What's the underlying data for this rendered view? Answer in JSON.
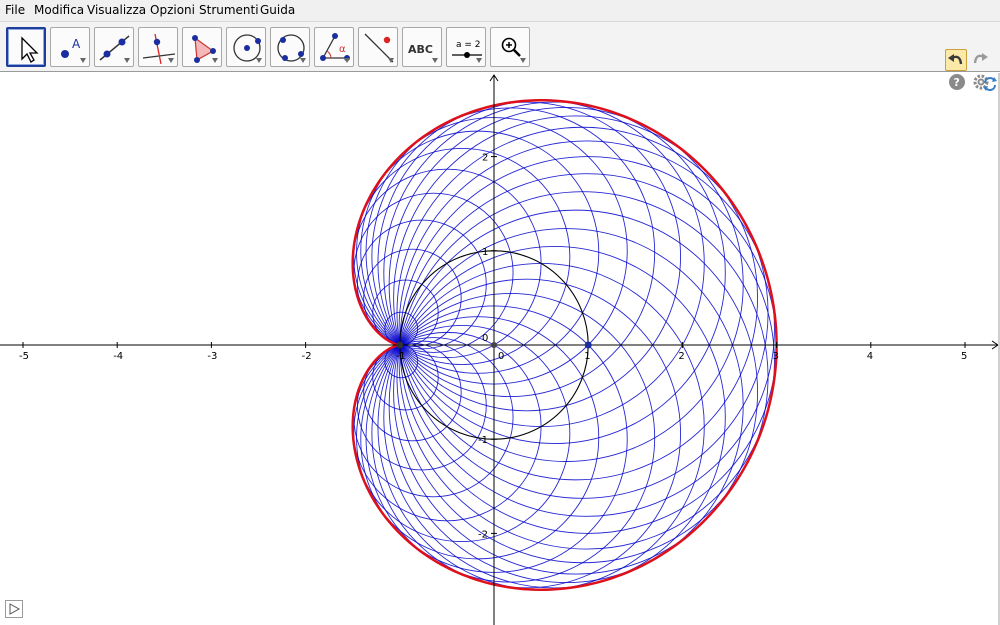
{
  "menu": [
    "File",
    "Modifica",
    "Visualizza",
    "Opzioni",
    "Strumenti",
    "Guida"
  ],
  "toolbar": {
    "tools": [
      {
        "name": "move-tool",
        "icon": "pointer-arrow-icon",
        "selected": true
      },
      {
        "name": "point-tool",
        "icon": "point-icon",
        "label": "A"
      },
      {
        "name": "line-tool",
        "icon": "line-through-points-icon"
      },
      {
        "name": "perpendicular-line-tool",
        "icon": "perpendicular-line-icon"
      },
      {
        "name": "polygon-tool",
        "icon": "polygon-icon"
      },
      {
        "name": "circle-center-point-tool",
        "icon": "circle-center-icon"
      },
      {
        "name": "circle-three-points-tool",
        "icon": "circle-three-points-icon"
      },
      {
        "name": "angle-tool",
        "icon": "angle-icon",
        "label": "α"
      },
      {
        "name": "reflect-tool",
        "icon": "reflect-about-line-icon"
      },
      {
        "name": "text-tool",
        "icon": "text-icon",
        "label": "ABC"
      },
      {
        "name": "slider-tool",
        "icon": "slider-icon",
        "label": "a = 2"
      },
      {
        "name": "zoom-in-tool",
        "icon": "zoom-in-icon"
      }
    ],
    "right": [
      "undo-icon",
      "redo-icon",
      "help-icon",
      "settings-icon"
    ]
  },
  "graphics": {
    "x_ticks": [
      "-5",
      "-4",
      "-3",
      "-2",
      "-1",
      "0",
      "1",
      "2",
      "3",
      "4",
      "5"
    ],
    "y_ticks": [
      "2",
      "1",
      "0",
      "-1",
      "-2"
    ],
    "origin_label": "0",
    "colors": {
      "cardioid": "#e0101a",
      "circles": "#0000cc",
      "base_circle": "#000000",
      "axes": "#000000"
    }
  },
  "chart_data": {
    "type": "line",
    "xlim": [
      -5.2,
      5.4
    ],
    "ylim": [
      -2.95,
      2.9
    ],
    "grid": false,
    "base_circle": {
      "center": [
        0,
        0
      ],
      "radius": 1
    },
    "fixed_point": [
      -1,
      0
    ],
    "moving_point": [
      1,
      0
    ],
    "envelope_circles": 36,
    "cardioid": "r = 2(1 + cos t) with cusp at (-1, 0)"
  }
}
